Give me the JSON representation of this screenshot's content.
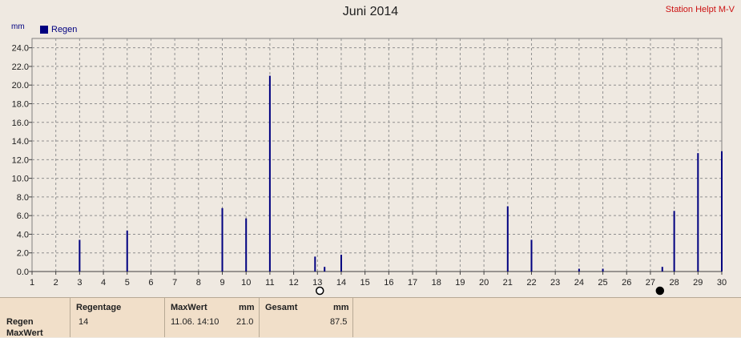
{
  "chart_data": {
    "type": "bar",
    "title": "Juni 2014",
    "station": "Station Helpt M-V",
    "unit": "mm",
    "legend": "Regen",
    "ylim": [
      0,
      25
    ],
    "yticks": [
      "0.0",
      "2.0",
      "4.0",
      "6.0",
      "8.0",
      "10.0",
      "12.0",
      "14.0",
      "16.0",
      "18.0",
      "20.0",
      "22.0",
      "24.0"
    ],
    "xticks": [
      "1",
      "2",
      "3",
      "4",
      "5",
      "6",
      "7",
      "8",
      "9",
      "10",
      "11",
      "12",
      "13",
      "14",
      "15",
      "16",
      "17",
      "18",
      "19",
      "20",
      "21",
      "22",
      "23",
      "24",
      "25",
      "26",
      "27",
      "28",
      "29",
      "30"
    ],
    "bars": [
      {
        "day": 3,
        "value": 3.4
      },
      {
        "day": 5,
        "value": 4.4
      },
      {
        "day": 9,
        "value": 6.8
      },
      {
        "day": 10,
        "value": 5.7
      },
      {
        "day": 11,
        "value": 21.0
      },
      {
        "day": 12.9,
        "value": 1.6
      },
      {
        "day": 13.3,
        "value": 0.5
      },
      {
        "day": 14,
        "value": 1.8
      },
      {
        "day": 21,
        "value": 7.0
      },
      {
        "day": 22,
        "value": 3.4
      },
      {
        "day": 24,
        "value": 0.3
      },
      {
        "day": 25,
        "value": 0.3
      },
      {
        "day": 27.5,
        "value": 0.5
      },
      {
        "day": 28,
        "value": 6.5
      },
      {
        "day": 29,
        "value": 12.7
      },
      {
        "day": 30,
        "value": 12.9
      }
    ],
    "moon_markers": [
      {
        "day": 13.1,
        "phase": "full"
      },
      {
        "day": 27.4,
        "phase": "new"
      }
    ],
    "grid": true,
    "bar_color": "#000080"
  },
  "table": {
    "row_labels": [
      "Regen",
      "MaxWert"
    ],
    "regentage_header": "Regentage",
    "regentage_value": "14",
    "maxwert_header": "MaxWert",
    "maxwert_unit": "mm",
    "maxwert_time": "11.06.  14:10",
    "maxwert_value": "21.0",
    "gesamt_header": "Gesamt",
    "gesamt_unit": "mm",
    "gesamt_value": "87.5"
  }
}
